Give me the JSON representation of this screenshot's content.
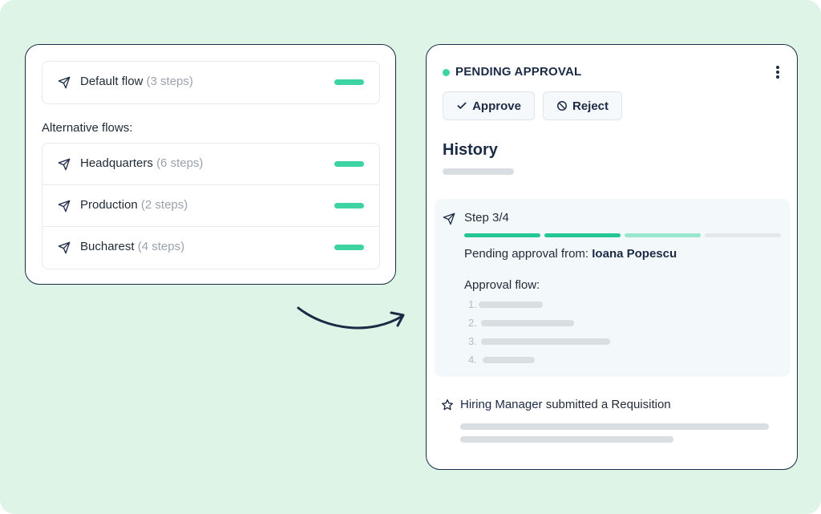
{
  "left_panel": {
    "default_flow": {
      "name": "Default flow",
      "steps": "(3 steps)",
      "icon": "send-icon"
    },
    "alternative_label": "Alternative flows:",
    "alternative_flows": [
      {
        "name": "Headquarters",
        "steps": "(6 steps)",
        "icon": "send-icon"
      },
      {
        "name": "Production",
        "steps": "(2 steps)",
        "icon": "send-icon"
      },
      {
        "name": "Bucharest",
        "steps": "(4 steps)",
        "icon": "send-icon"
      }
    ]
  },
  "right_panel": {
    "status": "PENDING APPROVAL",
    "status_color": "#3ed3a2",
    "approve_label": "Approve",
    "reject_label": "Reject",
    "history_title": "History",
    "step": {
      "label": "Step 3/4",
      "progress_colors": [
        "#24c792",
        "#24c792",
        "#98e6cb",
        "#e3e7ea"
      ],
      "pending_prefix": "Pending approval from:",
      "pending_name": "Ioana Popescu",
      "approval_flow_label": "Approval flow:",
      "approval_flow_numbers": [
        "1.",
        "2.",
        "3.",
        "4."
      ]
    },
    "event": {
      "actor": "Hiring Manager",
      "action": "submitted a Requisition",
      "icon": "star-icon"
    }
  },
  "colors": {
    "accent": "#3ed3a2",
    "navy": "#1b2a45",
    "background": "#def4e6"
  }
}
